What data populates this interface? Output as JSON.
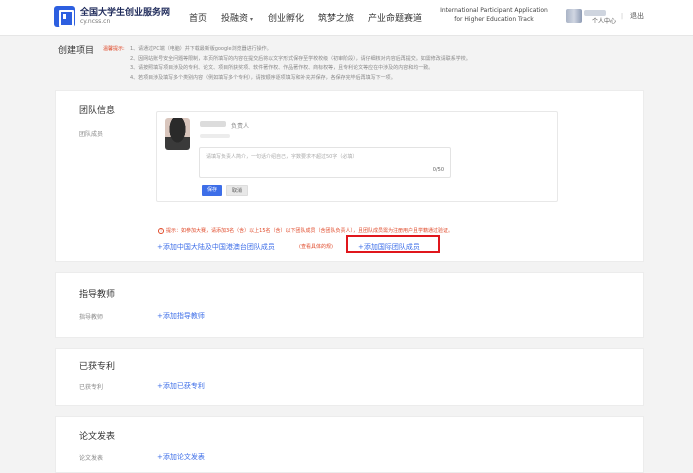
{
  "header": {
    "logo_title": "全国大学生创业服务网",
    "logo_sub": "cy.ncss.cn",
    "nav": [
      {
        "label": "首页"
      },
      {
        "label": "投融资",
        "caret": "▾"
      },
      {
        "label": "创业孵化"
      },
      {
        "label": "筑梦之旅"
      },
      {
        "label": "产业命题赛道"
      }
    ],
    "intl_line1": "International Participant Application",
    "intl_line2": "for Higher Education Track",
    "user_center": "个人中心",
    "separator": "|",
    "logout": "退出"
  },
  "create": {
    "title": "创建项目",
    "notice_label": "温馨提示:",
    "notice_lines": [
      "1、请通过PC端（电脑）并下载最新版google浏览器进行操作。",
      "2、因网站账号安全问题等限制，本页所填写的内容在提交后将以文字形式保存至学校校级（初审阶段），请仔细核对内容后再提交。如需修改请联系学校。",
      "3、请按照填写项目涉及的专利、论文、项目所获奖项、软件著作权、作品著作权、商标权等，且专利论文等应在中涉及的内容和均一致。",
      "4、若项目涉及填写多个类别内容（例如填写多个专利），请按顺序逐项填写和补充并保存，各保存完毕后再填写下一项。"
    ]
  },
  "team": {
    "title": "团队信息",
    "row_label": "团队成员",
    "member_role": "负责人",
    "textarea_placeholder": "请填写负责人简介，一句话介绍自己，字数要求不超过50字（必填）",
    "textarea_count": "0/50",
    "save": "保存",
    "cancel": "取消",
    "warn_icon": "!",
    "warn_text": "提示：如参加大赛，请添加3名（含）以上15名（含）以下团队成员（含团队负责人），且团队成员需为注册用户且学籍通过验证。",
    "add_domestic": "+添加中国大陆及中国港澳台团队成员",
    "add_domestic_note": "(查看具体的规)",
    "add_international": "+添加国际团队成员"
  },
  "advisor": {
    "title": "指导教师",
    "row_label": "指导教师",
    "add": "+添加指导教师"
  },
  "patent": {
    "title": "已获专利",
    "row_label": "已获专利",
    "add": "+添加已获专利"
  },
  "paper": {
    "title": "论文发表",
    "row_label": "论文发表",
    "add": "+添加论文发表"
  },
  "colors": {
    "accent": "#3d6ee8",
    "brand": "#2d5fe0",
    "warning": "#e04a2a",
    "highlight": "#e0161c"
  }
}
